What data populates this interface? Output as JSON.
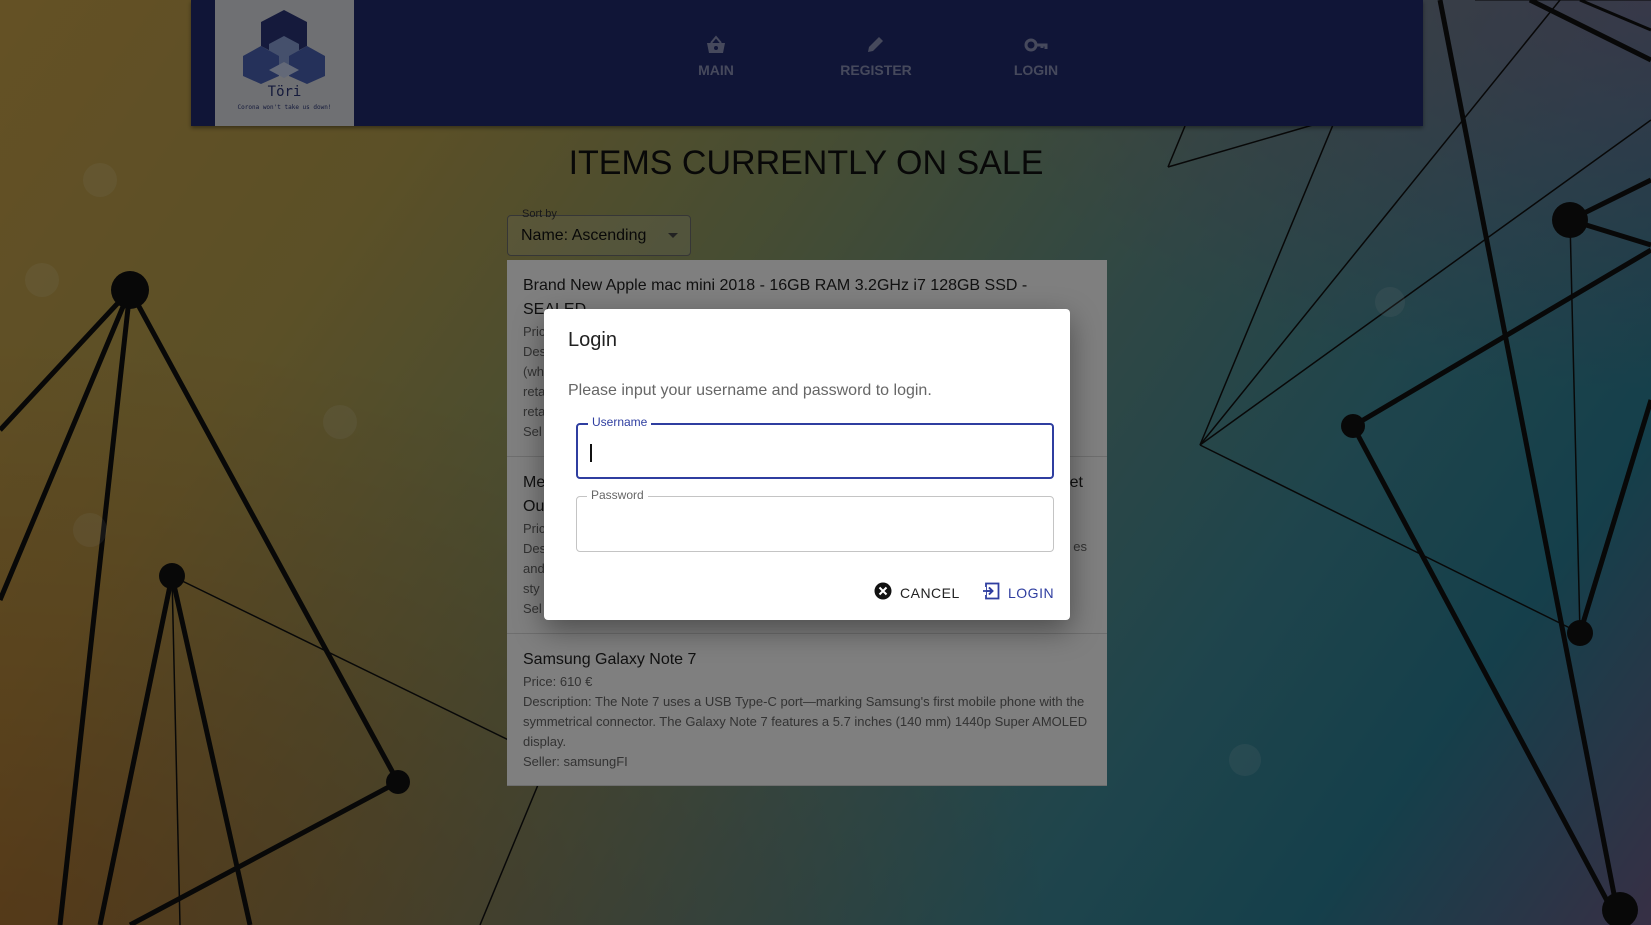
{
  "app": {
    "logo_name": "Töri",
    "logo_tagline": "Corona won't take us down!"
  },
  "nav": [
    {
      "label": "MAIN",
      "icon": "basket-icon"
    },
    {
      "label": "REGISTER",
      "icon": "pencil-icon"
    },
    {
      "label": "LOGIN",
      "icon": "key-icon"
    }
  ],
  "page": {
    "title": "ITEMS CURRENTLY ON SALE"
  },
  "sort": {
    "label": "Sort by",
    "value": "Name: Ascending"
  },
  "items": [
    {
      "title": "Brand New Apple mac mini 2018 - 16GB RAM 3.2GHz i7 128GB SSD - SEALED",
      "price": "Pric",
      "desc1": "Des",
      "desc2": "(wh",
      "desc3": "reta",
      "desc4": "reta",
      "seller": "Sel"
    },
    {
      "title": "Me",
      "title2": "Ou",
      "tail1": "et",
      "tail2": "es",
      "price": "Pric",
      "desc1": "Des",
      "desc2": "and",
      "desc3": "sty",
      "seller": "Sel"
    },
    {
      "title": "Samsung Galaxy Note 7",
      "price": "Price: 610 €",
      "desc": "Description: The Note 7 uses a USB Type-C port—marking Samsung's first mobile phone with the symmetrical connector. The Galaxy Note 7 features a 5.7 inches (140 mm) 1440p Super AMOLED display.",
      "seller": "Seller: samsungFI"
    }
  ],
  "dialog": {
    "title": "Login",
    "text": "Please input your username and password to login.",
    "username_label": "Username",
    "password_label": "Password",
    "cancel_label": "CANCEL",
    "login_label": "LOGIN"
  },
  "colors": {
    "appbar": "#212a6e",
    "accent": "#2f3ea0"
  }
}
